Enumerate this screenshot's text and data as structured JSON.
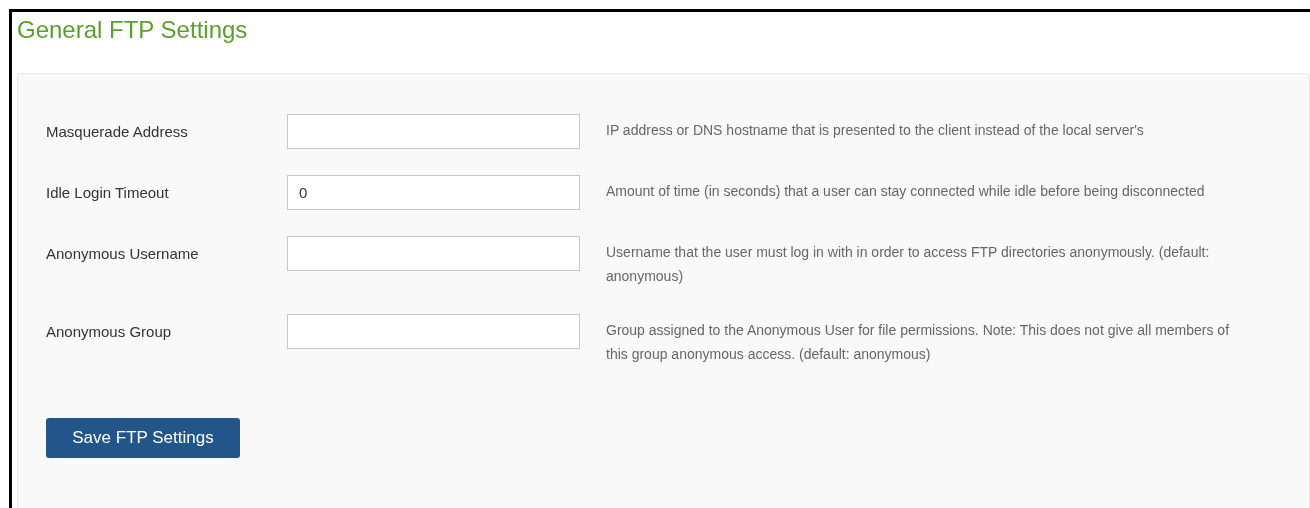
{
  "title": "General FTP Settings",
  "fields": [
    {
      "label": "Masquerade Address",
      "help": "IP address or DNS hostname that is presented to the client instead of the local server's"
    },
    {
      "label": "Idle Login Timeout",
      "value": "0",
      "help": "Amount of time (in seconds) that a user can stay connected while idle before being disconnected"
    },
    {
      "label": "Anonymous Username",
      "help": "Username that the user must log in with in order to access FTP directories anonymously. (default: anonymous)"
    },
    {
      "label": "Anonymous Group",
      "help": "Group assigned to the Anonymous User for file permissions. Note: This does not give all members of this group anonymous access. (default: anonymous)"
    }
  ],
  "save_button": "Save FTP Settings"
}
